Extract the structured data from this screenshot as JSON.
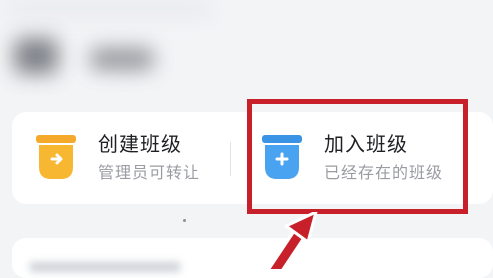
{
  "options": {
    "create": {
      "title": "创建班级",
      "subtitle": "管理员可转让"
    },
    "join": {
      "title": "加入班级",
      "subtitle": "已经存在的班级"
    }
  },
  "icons": {
    "create": "cup-arrow-icon",
    "join": "cup-plus-icon"
  },
  "colors": {
    "create_icon": "#f7b731",
    "join_icon": "#4aa3f0",
    "highlight": "#c8202a",
    "background": "#f3f4f6"
  }
}
